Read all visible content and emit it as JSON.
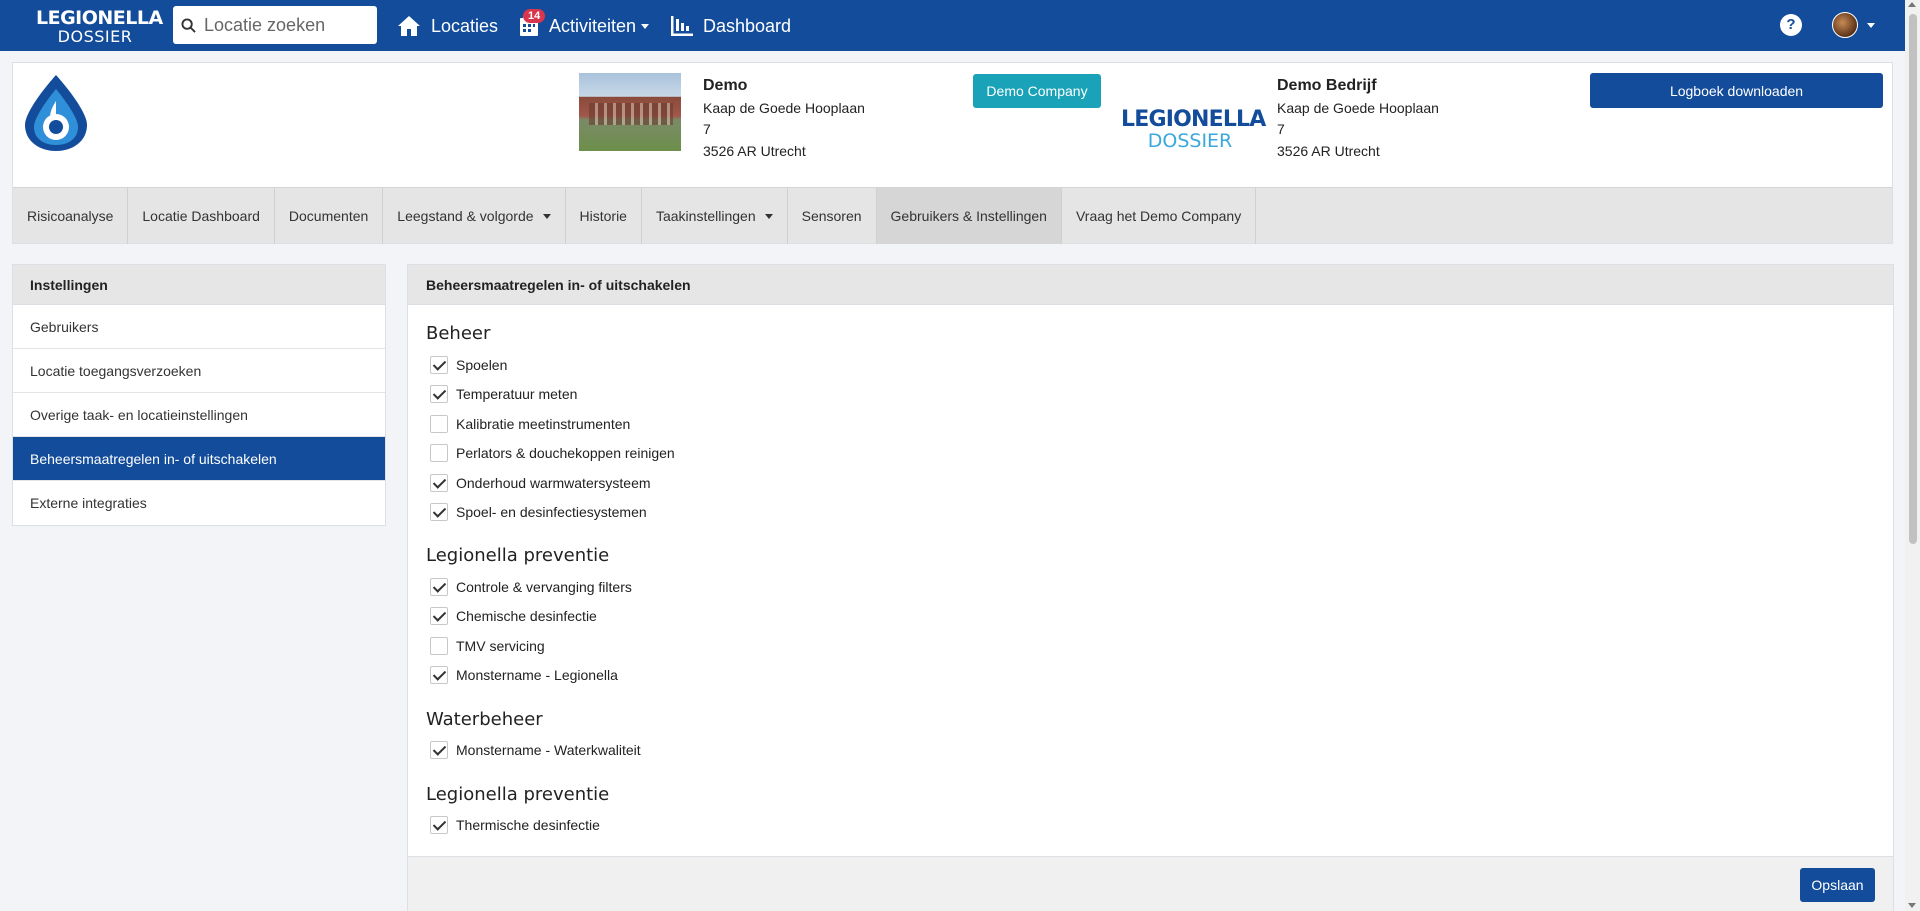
{
  "navbar": {
    "brand_line1": "LEGIONELLA",
    "brand_line2": "DOSSIER",
    "search_placeholder": "Locatie zoeken",
    "locations_label": "Locaties",
    "activities_label": "Activiteiten",
    "activities_badge": "14",
    "dashboard_label": "Dashboard",
    "help_label": "?"
  },
  "location": {
    "name": "Demo",
    "street": "Kaap de Goede Hooplaan",
    "number": "7",
    "city": "3526 AR Utrecht"
  },
  "company": {
    "button_label": "Demo Company",
    "logo_line1": "LEGIONELLA",
    "logo_line2": "DOSSIER",
    "name": "Demo Bedrijf",
    "street": "Kaap de Goede Hooplaan",
    "number": "7",
    "city": "3526 AR Utrecht"
  },
  "logbook_button": "Logboek downloaden",
  "tabs": [
    {
      "label": "Risicoanalyse"
    },
    {
      "label": "Locatie Dashboard"
    },
    {
      "label": "Documenten"
    },
    {
      "label": "Leegstand & volgorde"
    },
    {
      "label": "Historie"
    },
    {
      "label": "Taakinstellingen"
    },
    {
      "label": "Sensoren"
    },
    {
      "label": "Gebruikers & Instellingen"
    },
    {
      "label": "Vraag het Demo Company"
    }
  ],
  "sidebar": {
    "title": "Instellingen",
    "items": [
      {
        "label": "Gebruikers"
      },
      {
        "label": "Locatie toegangsverzoeken"
      },
      {
        "label": "Overige taak- en locatieinstellingen"
      },
      {
        "label": "Beheersmaatregelen in- of uitschakelen"
      },
      {
        "label": "Externe integraties"
      }
    ]
  },
  "main": {
    "title": "Beheersmaatregelen in- of uitschakelen",
    "groups": [
      {
        "title": "Beheer",
        "items": [
          {
            "label": "Spoelen",
            "checked": true
          },
          {
            "label": "Temperatuur meten",
            "checked": true
          },
          {
            "label": "Kalibratie meetinstrumenten",
            "checked": false
          },
          {
            "label": "Perlators & douchekoppen reinigen",
            "checked": false
          },
          {
            "label": "Onderhoud warmwatersysteem",
            "checked": true
          },
          {
            "label": "Spoel- en desinfectiesystemen",
            "checked": true
          }
        ]
      },
      {
        "title": "Legionella preventie",
        "items": [
          {
            "label": "Controle & vervanging filters",
            "checked": true
          },
          {
            "label": "Chemische desinfectie",
            "checked": true
          },
          {
            "label": "TMV servicing",
            "checked": false
          },
          {
            "label": "Monstername - Legionella",
            "checked": true
          }
        ]
      },
      {
        "title": "Waterbeheer",
        "items": [
          {
            "label": "Monstername - Waterkwaliteit",
            "checked": true
          }
        ]
      },
      {
        "title": "Legionella preventie",
        "items": [
          {
            "label": "Thermische desinfectie",
            "checked": true
          }
        ]
      }
    ],
    "save_label": "Opslaan"
  },
  "colors": {
    "primary": "#124c9a",
    "accent": "#1aa3b8",
    "badge": "#d9354c"
  }
}
